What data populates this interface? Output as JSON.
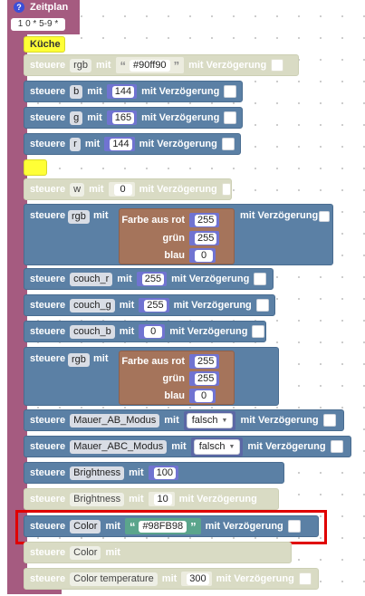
{
  "schedule": {
    "icon": "question-icon",
    "title": "Zeitplan",
    "cron": "1 0 * 5-9 *"
  },
  "labels": {
    "steuere": "steuere",
    "mit": "mit",
    "mit_verzoegerung": "mit Verzögerung"
  },
  "kueche": "Küche",
  "rgb_hex": {
    "state": "rgb",
    "value": "#90ff90"
  },
  "b": {
    "state": "b",
    "value": "144"
  },
  "g": {
    "state": "g",
    "value": "165"
  },
  "r": {
    "state": "r",
    "value": "144"
  },
  "w": {
    "state": "w",
    "value": "0"
  },
  "rgb_fn": {
    "state": "rgb",
    "label_rot": "Farbe aus rot",
    "label_gruen": "grün",
    "label_blau": "blau",
    "rot": "255",
    "gruen": "255",
    "blau": "0"
  },
  "couch_r": {
    "state": "couch_r",
    "value": "255"
  },
  "couch_g": {
    "state": "couch_g",
    "value": "255"
  },
  "couch_b": {
    "state": "couch_b",
    "value": "0"
  },
  "rgb_fn2": {
    "state": "rgb",
    "label_rot": "Farbe aus rot",
    "label_gruen": "grün",
    "label_blau": "blau",
    "rot": "255",
    "gruen": "255",
    "blau": "0"
  },
  "mauer_ab": {
    "state": "Mauer_AB_Modus",
    "value": "falsch"
  },
  "mauer_abc": {
    "state": "Mauer_ABC_Modus",
    "value": "falsch"
  },
  "brightness": {
    "state": "Brightness",
    "value": "100"
  },
  "brightness2": {
    "state": "Brightness",
    "value": "10"
  },
  "color": {
    "state": "Color",
    "value": "#98FB98"
  },
  "color2": {
    "state": "Color"
  },
  "colortemp": {
    "state": "Color temperature",
    "value": "300"
  },
  "colors": {
    "blue_block": "#5b80a5",
    "faded_block": "#d9dbc4",
    "highlight": "#e00000",
    "schedule": "#a55b80",
    "comment": "#ffff36"
  }
}
